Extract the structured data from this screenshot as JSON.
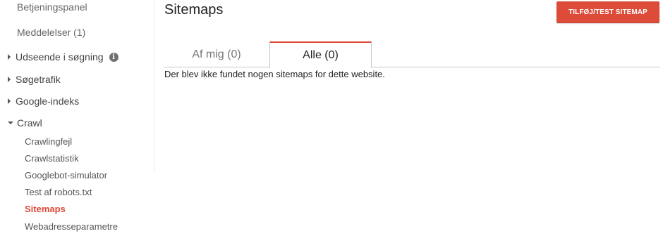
{
  "sidebar": {
    "dashboard": "Betjeningspanel",
    "messages": "Meddelelser (1)",
    "groups": {
      "search_appearance": "Udseende i søgning",
      "search_traffic": "Søgetrafik",
      "google_index": "Google-indeks",
      "crawl": "Crawl"
    },
    "info_icon_glyph": "i",
    "crawl_items": [
      "Crawlingfejl",
      "Crawlstatistik",
      "Googlebot-simulator",
      "Test af robots.txt",
      "Sitemaps",
      "Webadresseparametre"
    ],
    "active_item": "Sitemaps"
  },
  "header": {
    "title": "Sitemaps",
    "add_button_label": "TILFØJ/TEST SITEMAP"
  },
  "tabs": [
    {
      "label": "Af mig (0)",
      "active": false
    },
    {
      "label": "Alle (0)",
      "active": true
    }
  ],
  "main": {
    "empty_message": "Der blev ikke fundet nogen sitemaps for dette website."
  },
  "colors": {
    "accent": "#dd4b39",
    "active_text": "#dd4b39",
    "divider": "#c8c8c8"
  },
  "icons": {
    "info": "info-icon",
    "expand": "caret-right-icon",
    "collapse": "caret-down-icon"
  }
}
